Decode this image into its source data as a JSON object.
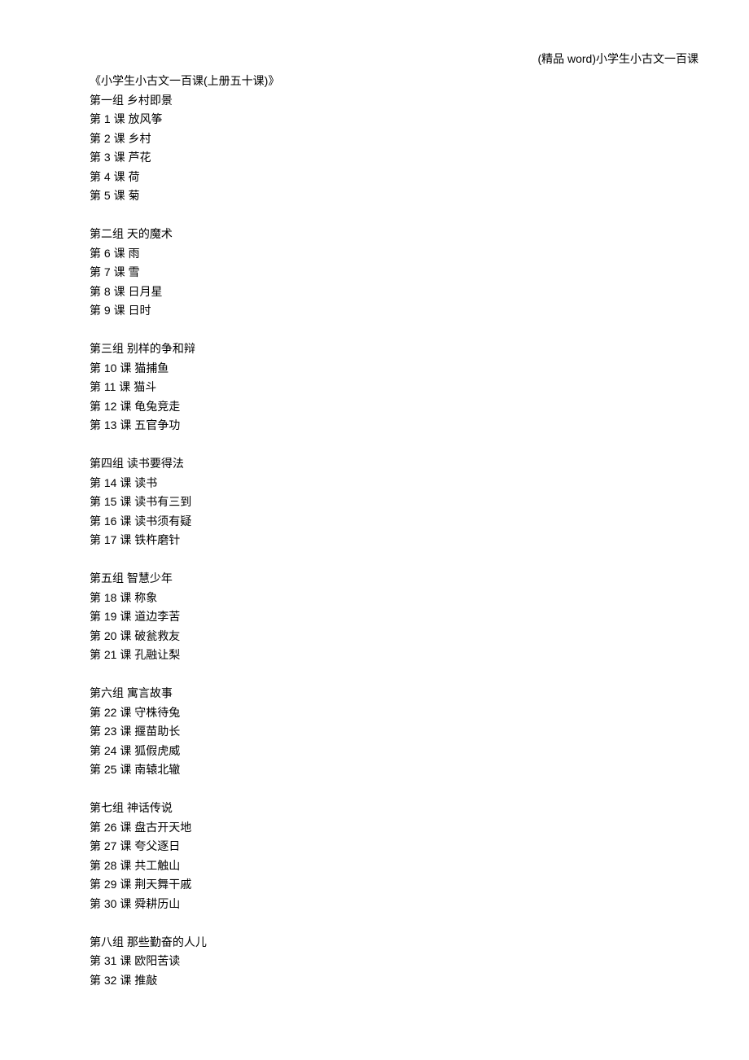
{
  "header": "(精品 word)小学生小古文一百课",
  "title": "《小学生小古文一百课(上册五十课)》",
  "groups": [
    {
      "header": "第一组  乡村即景",
      "lessons": [
        "第 1 课  放风筝",
        "第 2 课  乡村",
        "第 3 课  芦花",
        "第 4 课  荷",
        "第 5 课  菊"
      ]
    },
    {
      "header": "第二组  天的魔术",
      "lessons": [
        "第 6 课  雨",
        "第 7 课  雪",
        "第 8 课  日月星",
        "第 9 课  日时"
      ]
    },
    {
      "header": "第三组  别样的争和辩",
      "lessons": [
        "第 10 课  猫捕鱼",
        "第 11 课  猫斗",
        "第 12 课  龟兔竞走",
        "第 13 课  五官争功"
      ]
    },
    {
      "header": "第四组  读书要得法",
      "lessons": [
        "第 14 课  读书",
        "第 15 课  读书有三到",
        "第 16 课  读书须有疑",
        "第 17 课  铁杵磨针"
      ]
    },
    {
      "header": "第五组  智慧少年",
      "lessons": [
        "第 18 课  称象",
        "第 19 课  道边李苦",
        "第 20 课  破瓮救友",
        "第 21 课  孔融让梨"
      ]
    },
    {
      "header": "第六组  寓言故事",
      "lessons": [
        "第 22 课  守株待兔",
        "第 23 课  揠苗助长",
        "第 24 课  狐假虎威",
        "第 25 课  南辕北辙"
      ]
    },
    {
      "header": "第七组  神话传说",
      "lessons": [
        "第 26 课  盘古开天地",
        "第 27 课  夸父逐日",
        "第 28 课  共工触山",
        "第 29 课  荆天舞干戚",
        "第 30 课  舜耕历山"
      ]
    },
    {
      "header": "第八组  那些勤奋的人儿",
      "lessons": [
        "第 31 课  欧阳苦读",
        "第 32 课  推敲"
      ]
    }
  ]
}
